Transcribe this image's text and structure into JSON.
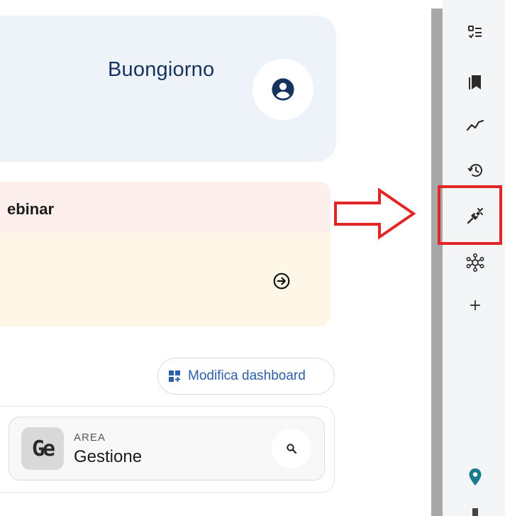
{
  "greeting": {
    "text": "Buongiorno",
    "avatar_icon": "account-circle-icon"
  },
  "webinar_card": {
    "title": "ebinar",
    "action_icon": "arrow-right-circle-icon"
  },
  "dashboard": {
    "edit_button_label": "Modifica dashboard",
    "edit_icon": "dashboard-customize-icon"
  },
  "area": {
    "logo_text": "Ge",
    "label": "AREA",
    "name": "Gestione",
    "search_icon": "search-icon"
  },
  "rail": {
    "items": [
      {
        "icon": "checklist-icon"
      },
      {
        "icon": "bookmarks-icon"
      },
      {
        "icon": "trending-line-icon"
      },
      {
        "icon": "history-icon"
      },
      {
        "icon": "plug-connect-icon"
      },
      {
        "icon": "network-hub-icon"
      },
      {
        "icon": "plus-icon",
        "glyph": "+"
      },
      {
        "icon": "location-pin-icon"
      }
    ]
  },
  "annotation": {
    "arrow_color": "#e22626",
    "highlight_color": "#e22626"
  },
  "colors": {
    "brand_dark": "#17325c",
    "link_blue": "#2b5fa8",
    "pin_teal": "#1b7a8c"
  }
}
